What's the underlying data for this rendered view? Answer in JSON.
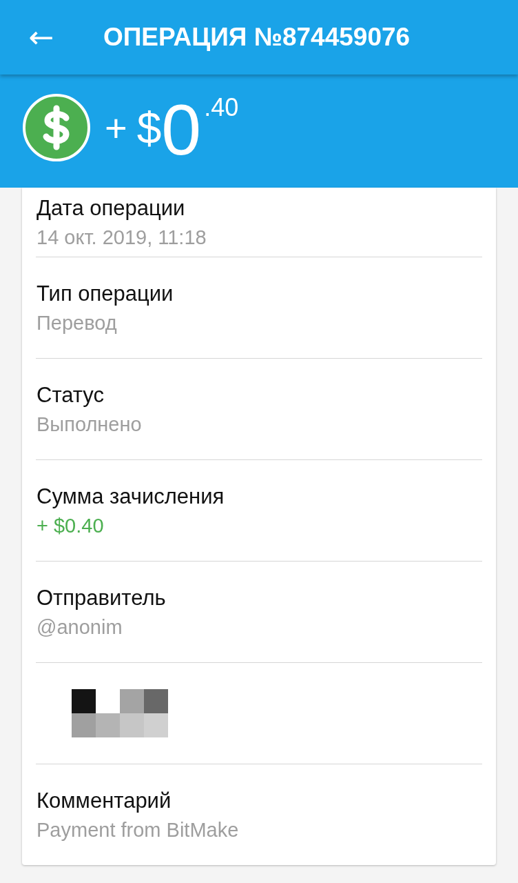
{
  "app_bar": {
    "back_icon": "←",
    "title": "ОПЕРАЦИЯ №874459076"
  },
  "amount": {
    "sign": "+",
    "currency": "$",
    "whole": "0",
    "fraction": ".40"
  },
  "details": [
    {
      "kind": "text",
      "label": "Дата операции",
      "value": "14 окт. 2019, 11:18",
      "positive": false
    },
    {
      "kind": "text",
      "label": "Тип операции",
      "value": "Перевод",
      "positive": false
    },
    {
      "kind": "text",
      "label": "Статус",
      "value": "Выполнено",
      "positive": false
    },
    {
      "kind": "text",
      "label": "Сумма зачисления",
      "value": "+ $0.40",
      "positive": true
    },
    {
      "kind": "text",
      "label": "Отправитель",
      "value": "@anonim",
      "positive": false
    },
    {
      "kind": "picture"
    },
    {
      "kind": "text",
      "label": "Комментарий",
      "value": "Payment from BitMake",
      "positive": false
    }
  ]
}
